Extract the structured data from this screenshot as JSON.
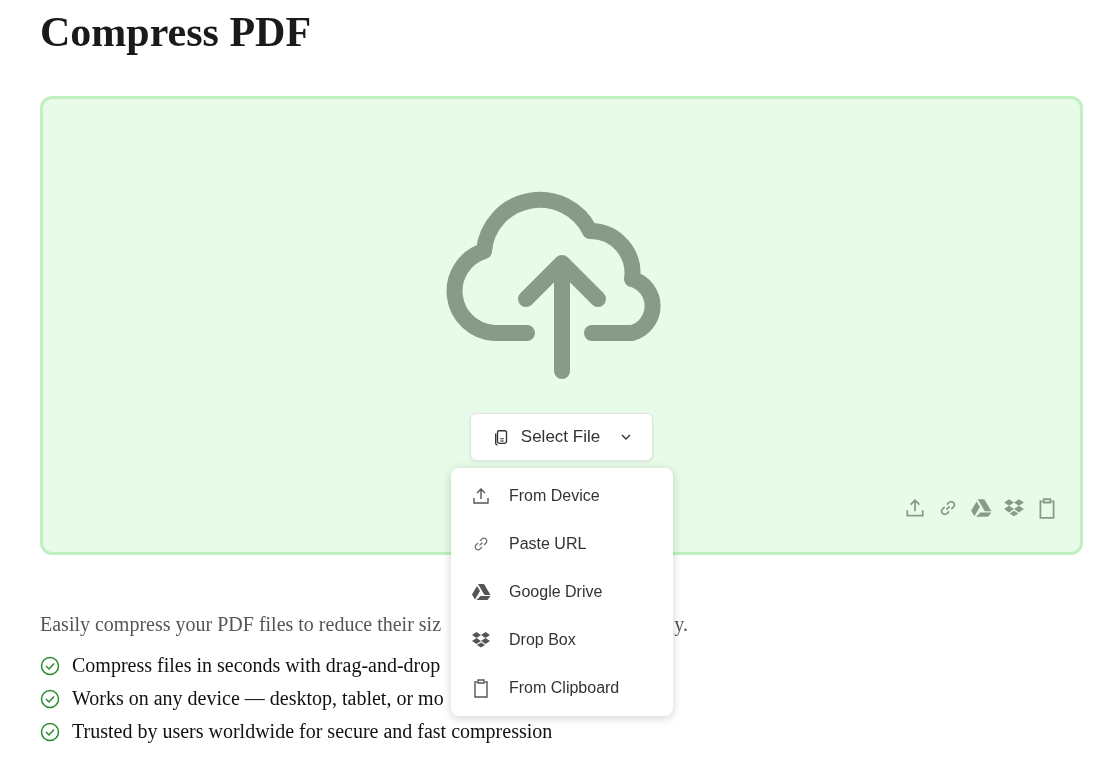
{
  "title": "Compress PDF",
  "dropzone": {
    "select_button": {
      "label": "Select File"
    },
    "menu": [
      {
        "kind": "device",
        "label": "From Device"
      },
      {
        "kind": "url",
        "label": "Paste URL"
      },
      {
        "kind": "drive",
        "label": "Google Drive"
      },
      {
        "kind": "dropbox",
        "label": "Drop Box"
      },
      {
        "kind": "clipboard",
        "label": "From Clipboard"
      }
    ]
  },
  "description": {
    "visible_start": "Easily compress your PDF files to reduce their siz",
    "visible_end": "y."
  },
  "features": [
    "Compress files in seconds with drag-and-drop",
    "Works on any device — desktop, tablet, or mo",
    "Trusted by users worldwide for secure and fast compression"
  ]
}
